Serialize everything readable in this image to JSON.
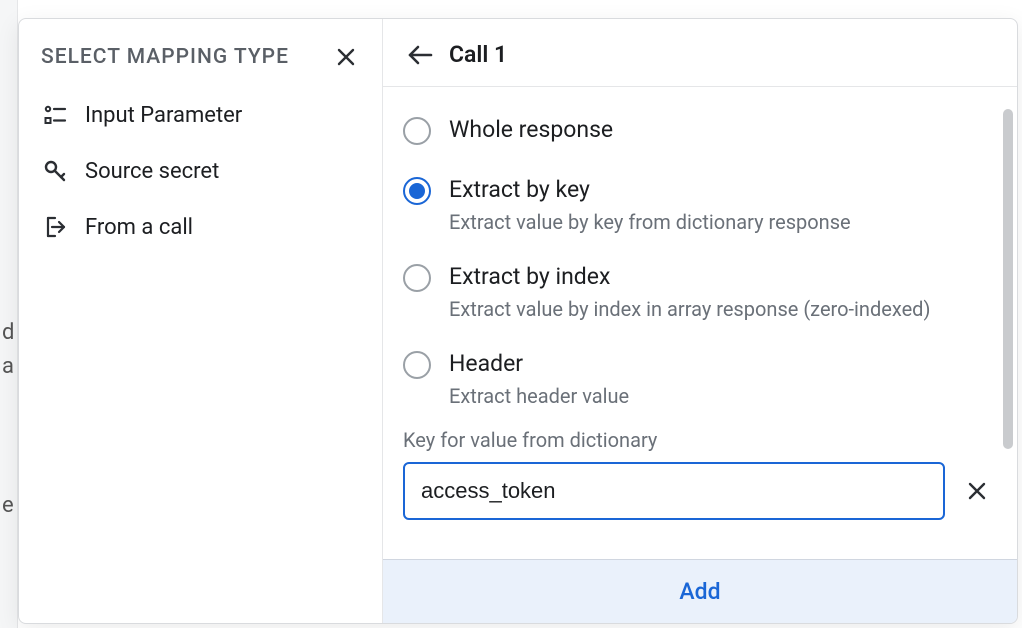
{
  "left": {
    "title": "SELECT MAPPING TYPE",
    "items": [
      {
        "label": "Input Parameter"
      },
      {
        "label": "Source secret"
      },
      {
        "label": "From a call"
      }
    ]
  },
  "right": {
    "title": "Call 1",
    "options": [
      {
        "label": "Whole response",
        "desc": "",
        "selected": false
      },
      {
        "label": "Extract by key",
        "desc": "Extract value by key from dictionary response",
        "selected": true
      },
      {
        "label": "Extract by index",
        "desc": "Extract value by index in array response (zero-indexed)",
        "selected": false
      },
      {
        "label": "Header",
        "desc": "Extract header value",
        "selected": false
      }
    ],
    "field_label": "Key for value from dictionary",
    "field_value": "access_token",
    "footer_button": "Add"
  }
}
